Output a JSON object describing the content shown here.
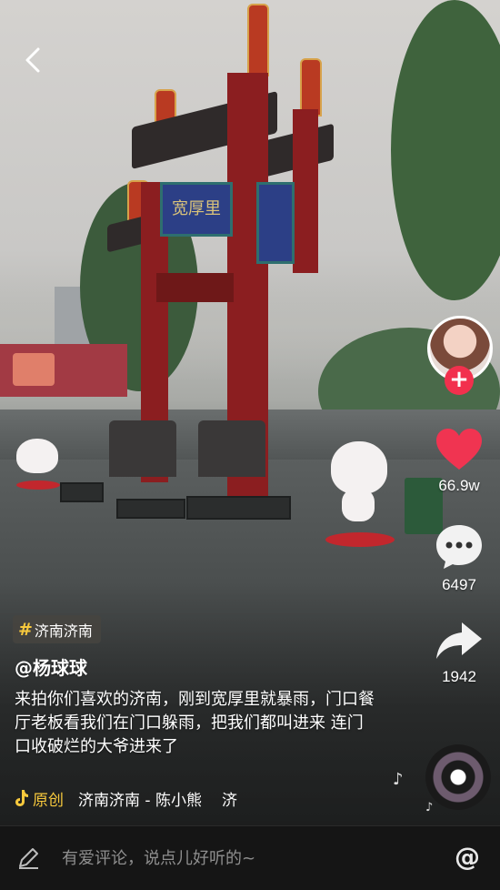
{
  "video": {
    "topic": "济南济南",
    "username": "@杨球球",
    "caption": "来拍你们喜欢的济南，刚到宽厚里就暴雨，门口餐厅老板看我们在门口躲雨，把我们都叫进来 连门口收破烂的大爷进来了",
    "sign_text": "宽厚里"
  },
  "music": {
    "origin_label": "原创",
    "track": "济南济南 - 陈小熊",
    "scrolling": "济"
  },
  "actions": {
    "like_count": "66.9w",
    "comment_count": "6497",
    "share_count": "1942"
  },
  "comment_bar": {
    "placeholder": "有爱评论，说点儿好听的~",
    "at_symbol": "@"
  },
  "colors": {
    "accent_red": "#f2304d",
    "like_red": "#f03451",
    "highlight_yellow": "#f7c93d",
    "bar_bg": "#151515"
  }
}
